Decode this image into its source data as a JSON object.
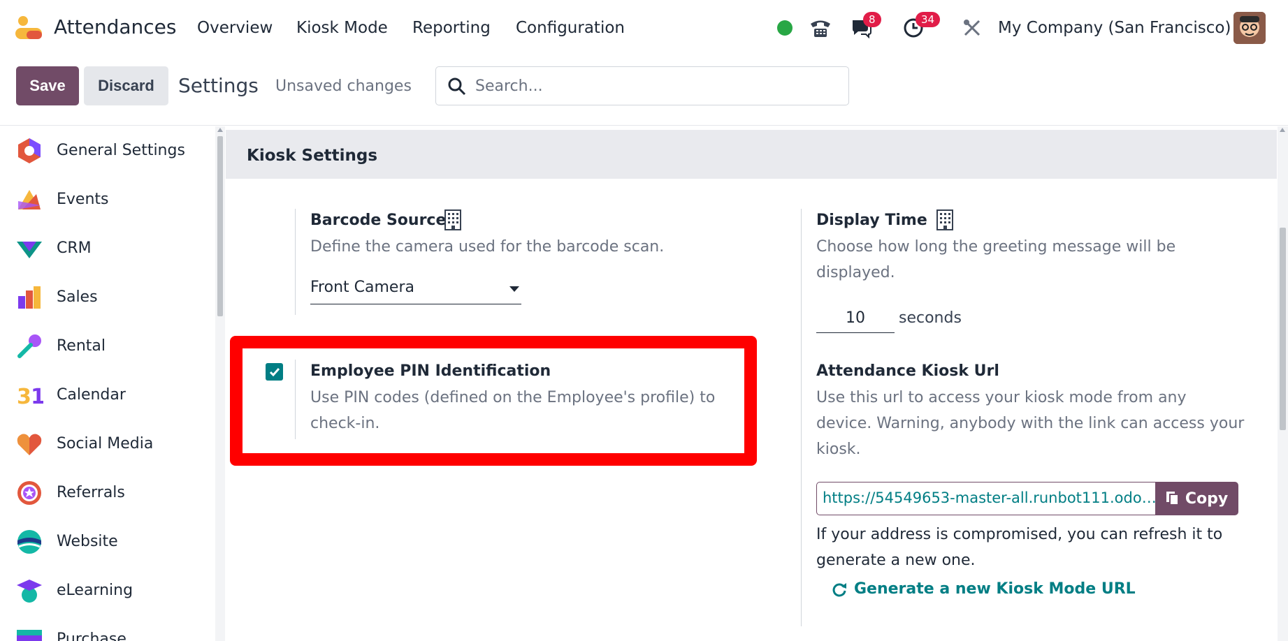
{
  "topnav": {
    "app_name": "Attendances",
    "menu": [
      "Overview",
      "Kiosk Mode",
      "Reporting",
      "Configuration"
    ],
    "chat_badge": "8",
    "activity_badge": "34",
    "company": "My Company (San Francisco)",
    "status_color": "#28a745"
  },
  "controlpanel": {
    "save_label": "Save",
    "discard_label": "Discard",
    "title": "Settings",
    "unsaved": "Unsaved changes",
    "search_placeholder": "Search..."
  },
  "sidebar": {
    "items": [
      {
        "label": "General Settings",
        "icon": "general-settings-icon"
      },
      {
        "label": "Events",
        "icon": "events-icon"
      },
      {
        "label": "CRM",
        "icon": "crm-icon"
      },
      {
        "label": "Sales",
        "icon": "sales-icon"
      },
      {
        "label": "Rental",
        "icon": "rental-icon"
      },
      {
        "label": "Calendar",
        "icon": "calendar-icon"
      },
      {
        "label": "Social Media",
        "icon": "social-media-icon"
      },
      {
        "label": "Referrals",
        "icon": "referrals-icon"
      },
      {
        "label": "Website",
        "icon": "website-icon"
      },
      {
        "label": "eLearning",
        "icon": "elearning-icon"
      },
      {
        "label": "Purchase",
        "icon": "purchase-icon"
      }
    ]
  },
  "kiosk": {
    "section_title": "Kiosk Settings",
    "barcode": {
      "title": "Barcode Source",
      "description": "Define the camera used for the barcode scan.",
      "value": "Front Camera"
    },
    "display_time": {
      "title": "Display Time",
      "description_line1": "Choose how long the greeting message will be",
      "description_line2": "displayed.",
      "value": "10",
      "unit": "seconds"
    },
    "pin": {
      "title": "Employee PIN Identification",
      "description_line1": "Use PIN codes (defined on the Employee's profile) to",
      "description_line2": "check-in.",
      "checked": true
    },
    "kiosk_url": {
      "title": "Attendance Kiosk Url",
      "description_line1": "Use this url to access your kiosk mode from any",
      "description_line2": "device. Warning, anybody with the link can access your",
      "description_line3": "kiosk.",
      "url": "https://54549653-master-all.runbot111.odo…",
      "copy_label": "Copy",
      "note_line1": "If your address is compromised, you can refresh it to",
      "note_line2": "generate a new one.",
      "regenerate_label": "Generate a new Kiosk Mode URL"
    }
  },
  "colors": {
    "brand": "#714b67",
    "teal": "#017e84",
    "highlight": "#ff0000"
  }
}
